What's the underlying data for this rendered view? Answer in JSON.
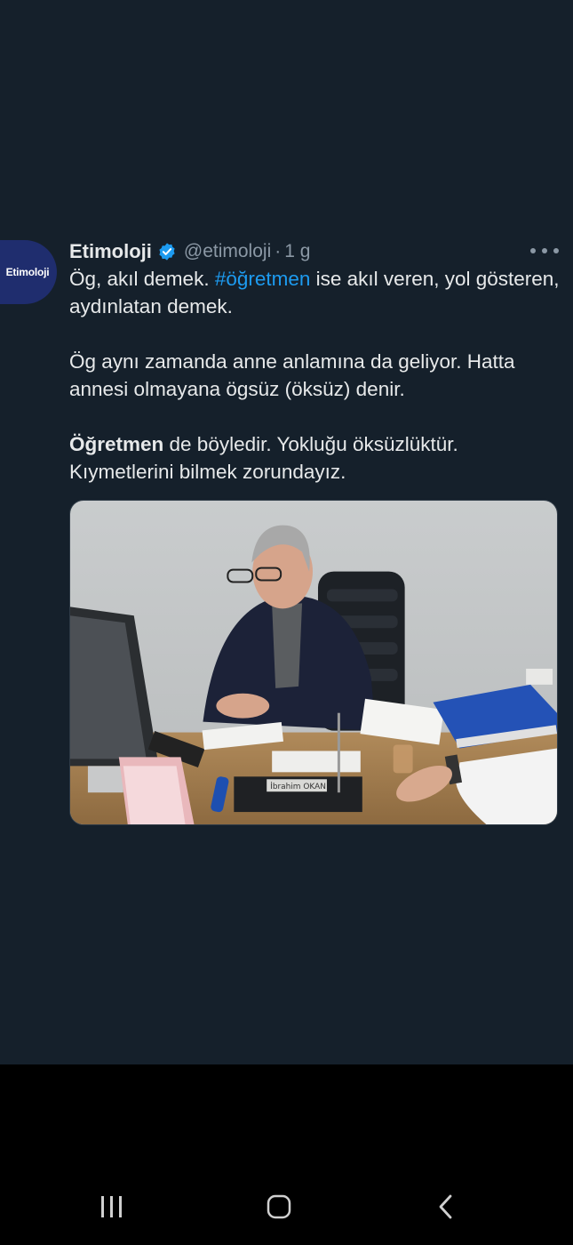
{
  "tweet": {
    "avatar_label": "Etimoloji",
    "display_name": "Etimoloji",
    "handle": "@etimoloji",
    "separator": "·",
    "age": "1 g",
    "paragraph1_before": "Ög, akıl demek. ",
    "paragraph1_hashtag": "#öğretmen",
    "paragraph1_after": " ise akıl veren, yol gösteren, aydınlatan demek.",
    "paragraph2": "Ög aynı zamanda anne anlamına da geliyor. Hatta annesi olmayana ögsüz (öksüz) denir.",
    "paragraph3_bold": "Öğretmen",
    "paragraph3_rest": " de böyledir. Yokluğu öksüzlüktür. Kıymetlerini bilmek zorundayız.",
    "media_nameplate": "İbrahim OKAN"
  },
  "icons": {
    "verified": "verified-badge-icon",
    "more": "more-options-icon",
    "recents": "recents-icon",
    "home": "home-icon",
    "back": "back-icon"
  },
  "colors": {
    "background": "#15202b",
    "primary_text": "#e7e9ea",
    "secondary_text": "#8b98a5",
    "accent": "#1d9bf0",
    "avatar_bg": "#1f2d6e"
  }
}
